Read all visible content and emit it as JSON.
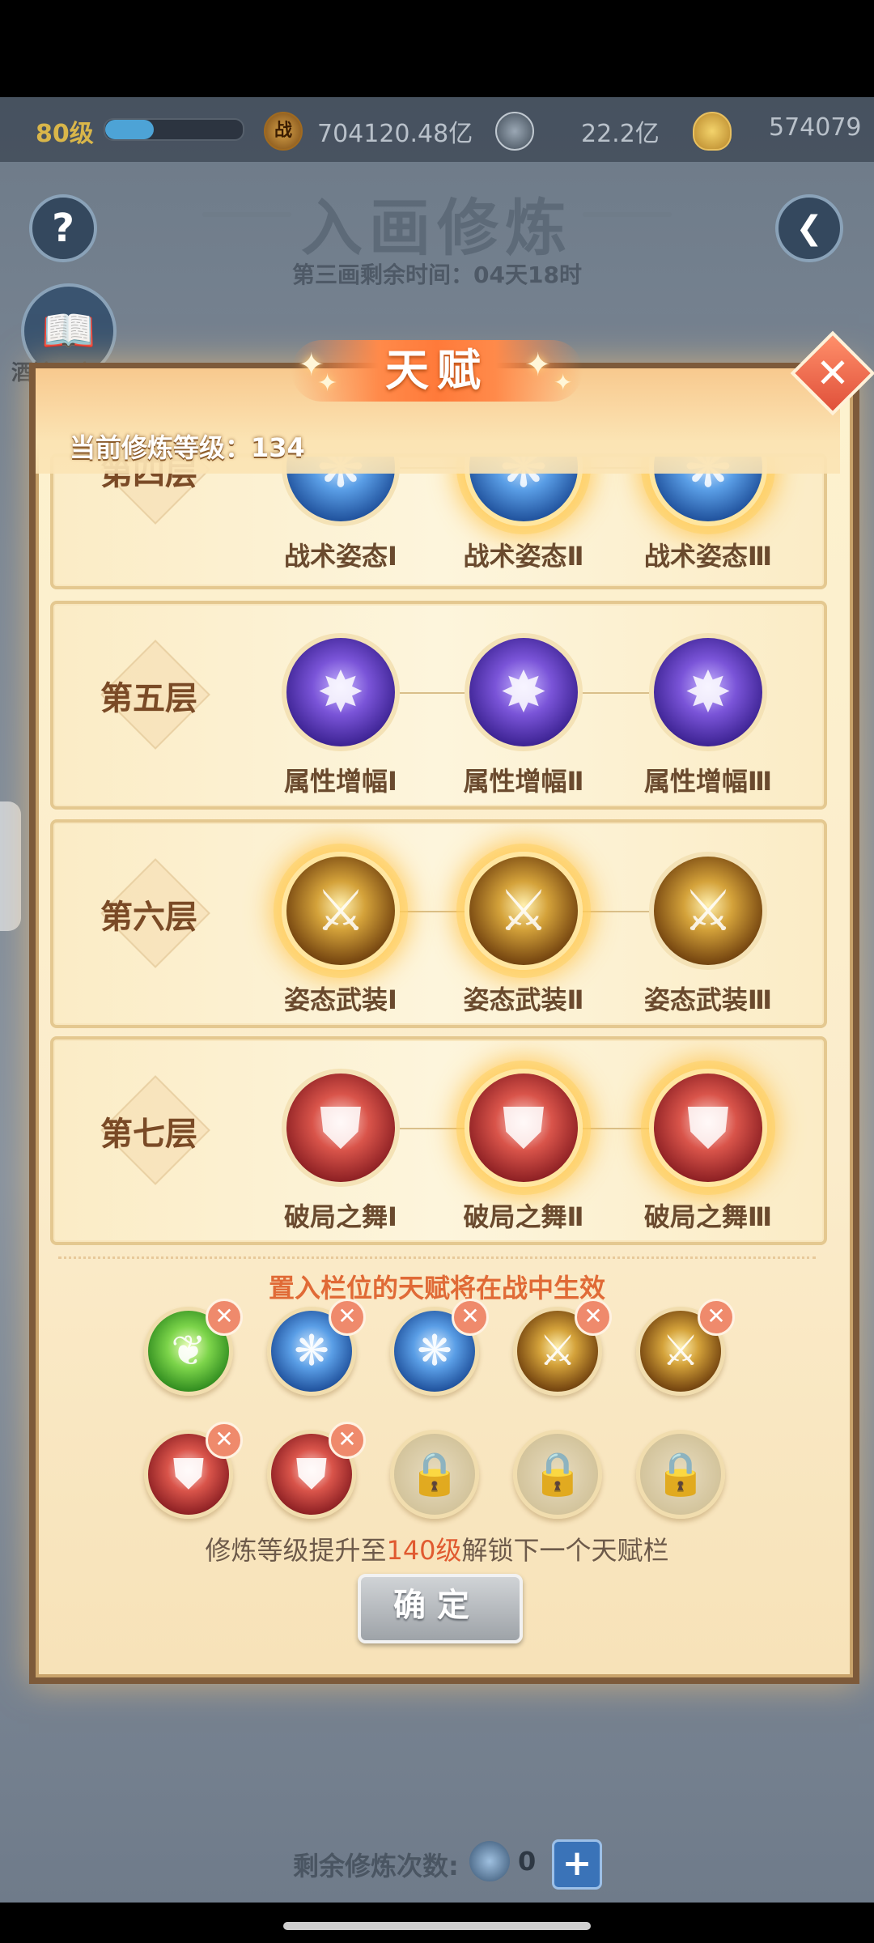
{
  "topbar": {
    "level": "80级",
    "exp_progress": 0.35,
    "power_icon_glyph": "战",
    "power": "704120.48亿",
    "silver": "22.2亿",
    "gold": "574079"
  },
  "header": {
    "title": "入画修炼",
    "subtitle": "第三画剩余时间：04天18时",
    "help_glyph": "?",
    "back_glyph": "❮",
    "book_glyph": "📖",
    "book_label": "酒馆开启"
  },
  "modal": {
    "title": "天赋",
    "close_glyph": "✕",
    "level_prefix": "当前修炼等级：",
    "level_value": "134",
    "layers": [
      {
        "name": "第四层",
        "talents": [
          {
            "label": "战术姿态Ⅰ",
            "color": "blue",
            "icon": "tactic-icon",
            "active": false
          },
          {
            "label": "战术姿态Ⅱ",
            "color": "blue",
            "icon": "tactic-icon",
            "active": true
          },
          {
            "label": "战术姿态Ⅲ",
            "color": "blue",
            "icon": "tactic-icon",
            "active": true
          }
        ]
      },
      {
        "name": "第五层",
        "talents": [
          {
            "label": "属性增幅Ⅰ",
            "color": "purple",
            "icon": "amplify-icon",
            "active": false
          },
          {
            "label": "属性增幅Ⅱ",
            "color": "purple",
            "icon": "amplify-icon",
            "active": false
          },
          {
            "label": "属性增幅Ⅲ",
            "color": "purple",
            "icon": "amplify-icon",
            "active": false
          }
        ]
      },
      {
        "name": "第六层",
        "talents": [
          {
            "label": "姿态武装Ⅰ",
            "color": "gold",
            "icon": "sword-icon",
            "active": true
          },
          {
            "label": "姿态武装Ⅱ",
            "color": "gold",
            "icon": "sword-icon",
            "active": true
          },
          {
            "label": "姿态武装Ⅲ",
            "color": "gold",
            "icon": "sword-icon",
            "active": false
          }
        ]
      },
      {
        "name": "第七层",
        "talents": [
          {
            "label": "破局之舞Ⅰ",
            "color": "red",
            "icon": "shield-icon",
            "active": false
          },
          {
            "label": "破局之舞Ⅱ",
            "color": "red",
            "icon": "shield-icon",
            "active": true
          },
          {
            "label": "破局之舞Ⅲ",
            "color": "red",
            "icon": "shield-icon",
            "active": true
          }
        ]
      }
    ],
    "slots_caption": "置入栏位的天赋将在战中生效",
    "slots": [
      {
        "color": "green",
        "icon": "leaf-icon",
        "locked": false
      },
      {
        "color": "blue",
        "icon": "tactic-icon",
        "locked": false
      },
      {
        "color": "blue",
        "icon": "tactic-icon",
        "locked": false
      },
      {
        "color": "gold",
        "icon": "sword-icon",
        "locked": false
      },
      {
        "color": "gold",
        "icon": "sword-icon",
        "locked": false
      },
      {
        "color": "red",
        "icon": "shield-icon",
        "locked": false
      },
      {
        "color": "red",
        "icon": "shield-icon",
        "locked": false
      },
      {
        "color": "lock",
        "icon": "lock-icon",
        "locked": true
      },
      {
        "color": "lock",
        "icon": "lock-icon",
        "locked": true
      },
      {
        "color": "lock",
        "icon": "lock-icon",
        "locked": true
      }
    ],
    "unlock_prefix": "修炼等级提升至",
    "unlock_level": "140级",
    "unlock_suffix": "解锁下一个天赋栏",
    "confirm_label": "确定"
  },
  "footer": {
    "remaining_label": "剩余修炼次数:",
    "remaining_value": "0",
    "plus_glyph": "+"
  }
}
